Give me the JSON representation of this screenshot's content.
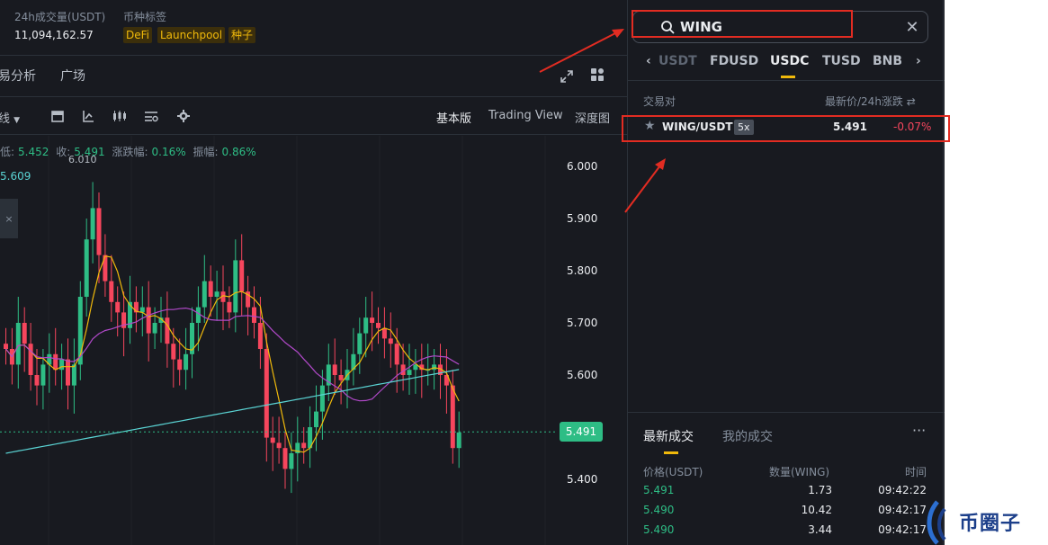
{
  "stats": {
    "volume_label": "24h成交量(USDT)",
    "volume_value": "11,094,162.57",
    "tags_label": "币种标签",
    "tags": [
      "DeFi",
      "Launchpool",
      "种子"
    ]
  },
  "nav": {
    "tab_analysis": "易分析",
    "tab_square": "广场"
  },
  "toolbar": {
    "interval": "线",
    "view_basic": "基本版",
    "view_tradingview": "Trading View",
    "view_depth": "深度图"
  },
  "ohlc": {
    "low_label": "低:",
    "low_value": "5.452",
    "close_label": "收:",
    "close_value": "5.491",
    "change_label": "涨跌幅:",
    "change_value": "0.16%",
    "amp_label": "振幅:",
    "amp_value": "0.86%"
  },
  "chart": {
    "ma_value": "5.609",
    "max_label": "6.010",
    "last_price": "5.491",
    "y_ticks": [
      "6.000",
      "5.900",
      "5.800",
      "5.700",
      "5.600",
      "5.400"
    ],
    "colors": {
      "up": "#2ebd85",
      "down": "#f6465d",
      "ma7": "#f0b90b",
      "ma25": "#b149c9",
      "ma99": "#5ad4d4"
    }
  },
  "chart_data": {
    "type": "candlestick",
    "ylim": [
      5.4,
      6.0
    ],
    "last": 5.491,
    "max": 6.01
  },
  "search": {
    "value": "WING",
    "placeholder": ""
  },
  "quote_tabs": [
    "USDT",
    "FDUSD",
    "USDC",
    "TUSD",
    "BNB"
  ],
  "quote_active": "USDC",
  "list_headers": {
    "pair": "交易对",
    "price_change": "最新价/24h涨跌"
  },
  "pair": {
    "name": "WING/USDT",
    "leverage": "5x",
    "price": "5.491",
    "change": "-0.07%"
  },
  "trades": {
    "tab_latest": "最新成交",
    "tab_mine": "我的成交",
    "more": "···",
    "headers": {
      "price": "价格(USDT)",
      "qty": "数量(WING)",
      "time": "时间"
    },
    "rows": [
      {
        "price": "5.491",
        "qty": "1.73",
        "time": "09:42:22"
      },
      {
        "price": "5.490",
        "qty": "10.42",
        "time": "09:42:17"
      },
      {
        "price": "5.490",
        "qty": "3.44",
        "time": "09:42:17"
      }
    ]
  },
  "brand": {
    "text": "币圈子"
  }
}
